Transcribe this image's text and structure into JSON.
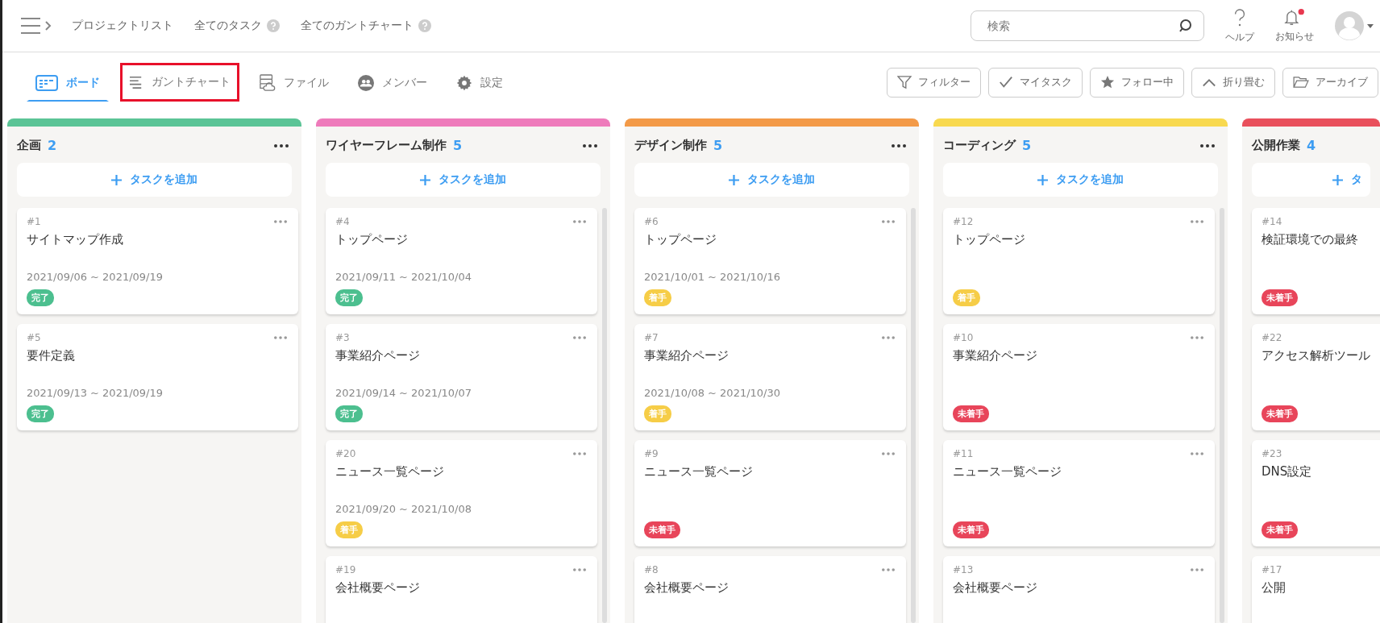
{
  "header": {
    "breadcrumbs": [
      {
        "label": "プロジェクトリスト",
        "help": false
      },
      {
        "label": "全てのタスク",
        "help": true
      },
      {
        "label": "全てのガントチャート",
        "help": true
      }
    ],
    "search": {
      "placeholder": "検索"
    },
    "help": {
      "label": "ヘルプ"
    },
    "notifications": {
      "label": "お知らせ",
      "unread": true
    }
  },
  "tabs": [
    {
      "kind": "board",
      "label": "ボード",
      "selected": true,
      "highlighted": false
    },
    {
      "kind": "gantt",
      "label": "ガントチャート",
      "selected": false,
      "highlighted": true
    },
    {
      "kind": "files",
      "label": "ファイル",
      "selected": false,
      "highlighted": false
    },
    {
      "kind": "members",
      "label": "メンバー",
      "selected": false,
      "highlighted": false
    },
    {
      "kind": "settings",
      "label": "設定",
      "selected": false,
      "highlighted": false
    }
  ],
  "toolbar": [
    {
      "kind": "filter",
      "label": "フィルター"
    },
    {
      "kind": "check",
      "label": "マイタスク"
    },
    {
      "kind": "star",
      "label": "フォロー中"
    },
    {
      "kind": "collapse",
      "label": "折り畳む"
    },
    {
      "kind": "folder",
      "label": "アーカイブ"
    }
  ],
  "columns": [
    {
      "title": "企画",
      "count": "2",
      "color": "#5bc496",
      "add_label": "タスクを追加",
      "show_menus": true,
      "scrollbar": false,
      "cards": [
        {
          "number": "#1",
          "title": "サイトマップ作成",
          "dates": "2021/09/06 ~ 2021/09/19",
          "status": {
            "label": "完了",
            "color": "#4cbf8f"
          }
        },
        {
          "number": "#5",
          "title": "要件定義",
          "dates": "2021/09/13 ~ 2021/09/19",
          "status": {
            "label": "完了",
            "color": "#4cbf8f"
          }
        }
      ]
    },
    {
      "title": "ワイヤーフレーム制作",
      "count": "5",
      "color": "#ee7bbb",
      "add_label": "タスクを追加",
      "show_menus": true,
      "scrollbar": true,
      "cards": [
        {
          "number": "#4",
          "title": "トップページ",
          "dates": "2021/09/11 ~ 2021/10/04",
          "status": {
            "label": "完了",
            "color": "#4cbf8f"
          }
        },
        {
          "number": "#3",
          "title": "事業紹介ページ",
          "dates": "2021/09/14 ~ 2021/10/07",
          "status": {
            "label": "完了",
            "color": "#4cbf8f"
          }
        },
        {
          "number": "#20",
          "title": "ニュース一覧ページ",
          "dates": "2021/09/20 ~ 2021/10/08",
          "status": {
            "label": "着手",
            "color": "#f6cd47"
          }
        },
        {
          "number": "#19",
          "title": "会社概要ページ"
        }
      ]
    },
    {
      "title": "デザイン制作",
      "count": "5",
      "color": "#f39a48",
      "add_label": "タスクを追加",
      "show_menus": true,
      "scrollbar": true,
      "cards": [
        {
          "number": "#6",
          "title": "トップページ",
          "dates": "2021/10/01 ~ 2021/10/16",
          "status": {
            "label": "着手",
            "color": "#f6cd47"
          }
        },
        {
          "number": "#7",
          "title": "事業紹介ページ",
          "dates": "2021/10/08 ~ 2021/10/30",
          "status": {
            "label": "着手",
            "color": "#f6cd47"
          }
        },
        {
          "number": "#9",
          "title": "ニュース一覧ページ",
          "status": {
            "label": "未着手",
            "color": "#e8455a"
          }
        },
        {
          "number": "#8",
          "title": "会社概要ページ"
        }
      ]
    },
    {
      "title": "コーディング",
      "count": "5",
      "color": "#f8d94f",
      "add_label": "タスクを追加",
      "show_menus": true,
      "scrollbar": true,
      "cards": [
        {
          "number": "#12",
          "title": "トップページ",
          "status": {
            "label": "着手",
            "color": "#f6cd47"
          }
        },
        {
          "number": "#10",
          "title": "事業紹介ページ",
          "status": {
            "label": "未着手",
            "color": "#e8455a"
          }
        },
        {
          "number": "#11",
          "title": "ニュース一覧ページ",
          "status": {
            "label": "未着手",
            "color": "#e8455a"
          }
        },
        {
          "number": "#13",
          "title": "会社概要ページ"
        }
      ]
    },
    {
      "title": "公開作業",
      "count": "4",
      "color": "#e9505c",
      "add_label": "タ",
      "show_menus": false,
      "scrollbar": false,
      "cards": [
        {
          "number": "#14",
          "title": "検証環境での最終",
          "status": {
            "label": "未着手",
            "color": "#e8455a"
          }
        },
        {
          "number": "#22",
          "title": "アクセス解析ツール",
          "status": {
            "label": "未着手",
            "color": "#e8455a"
          }
        },
        {
          "number": "#23",
          "title": "DNS設定",
          "status": {
            "label": "未着手",
            "color": "#e8455a"
          }
        },
        {
          "number": "#17",
          "title": "公開"
        }
      ]
    }
  ]
}
